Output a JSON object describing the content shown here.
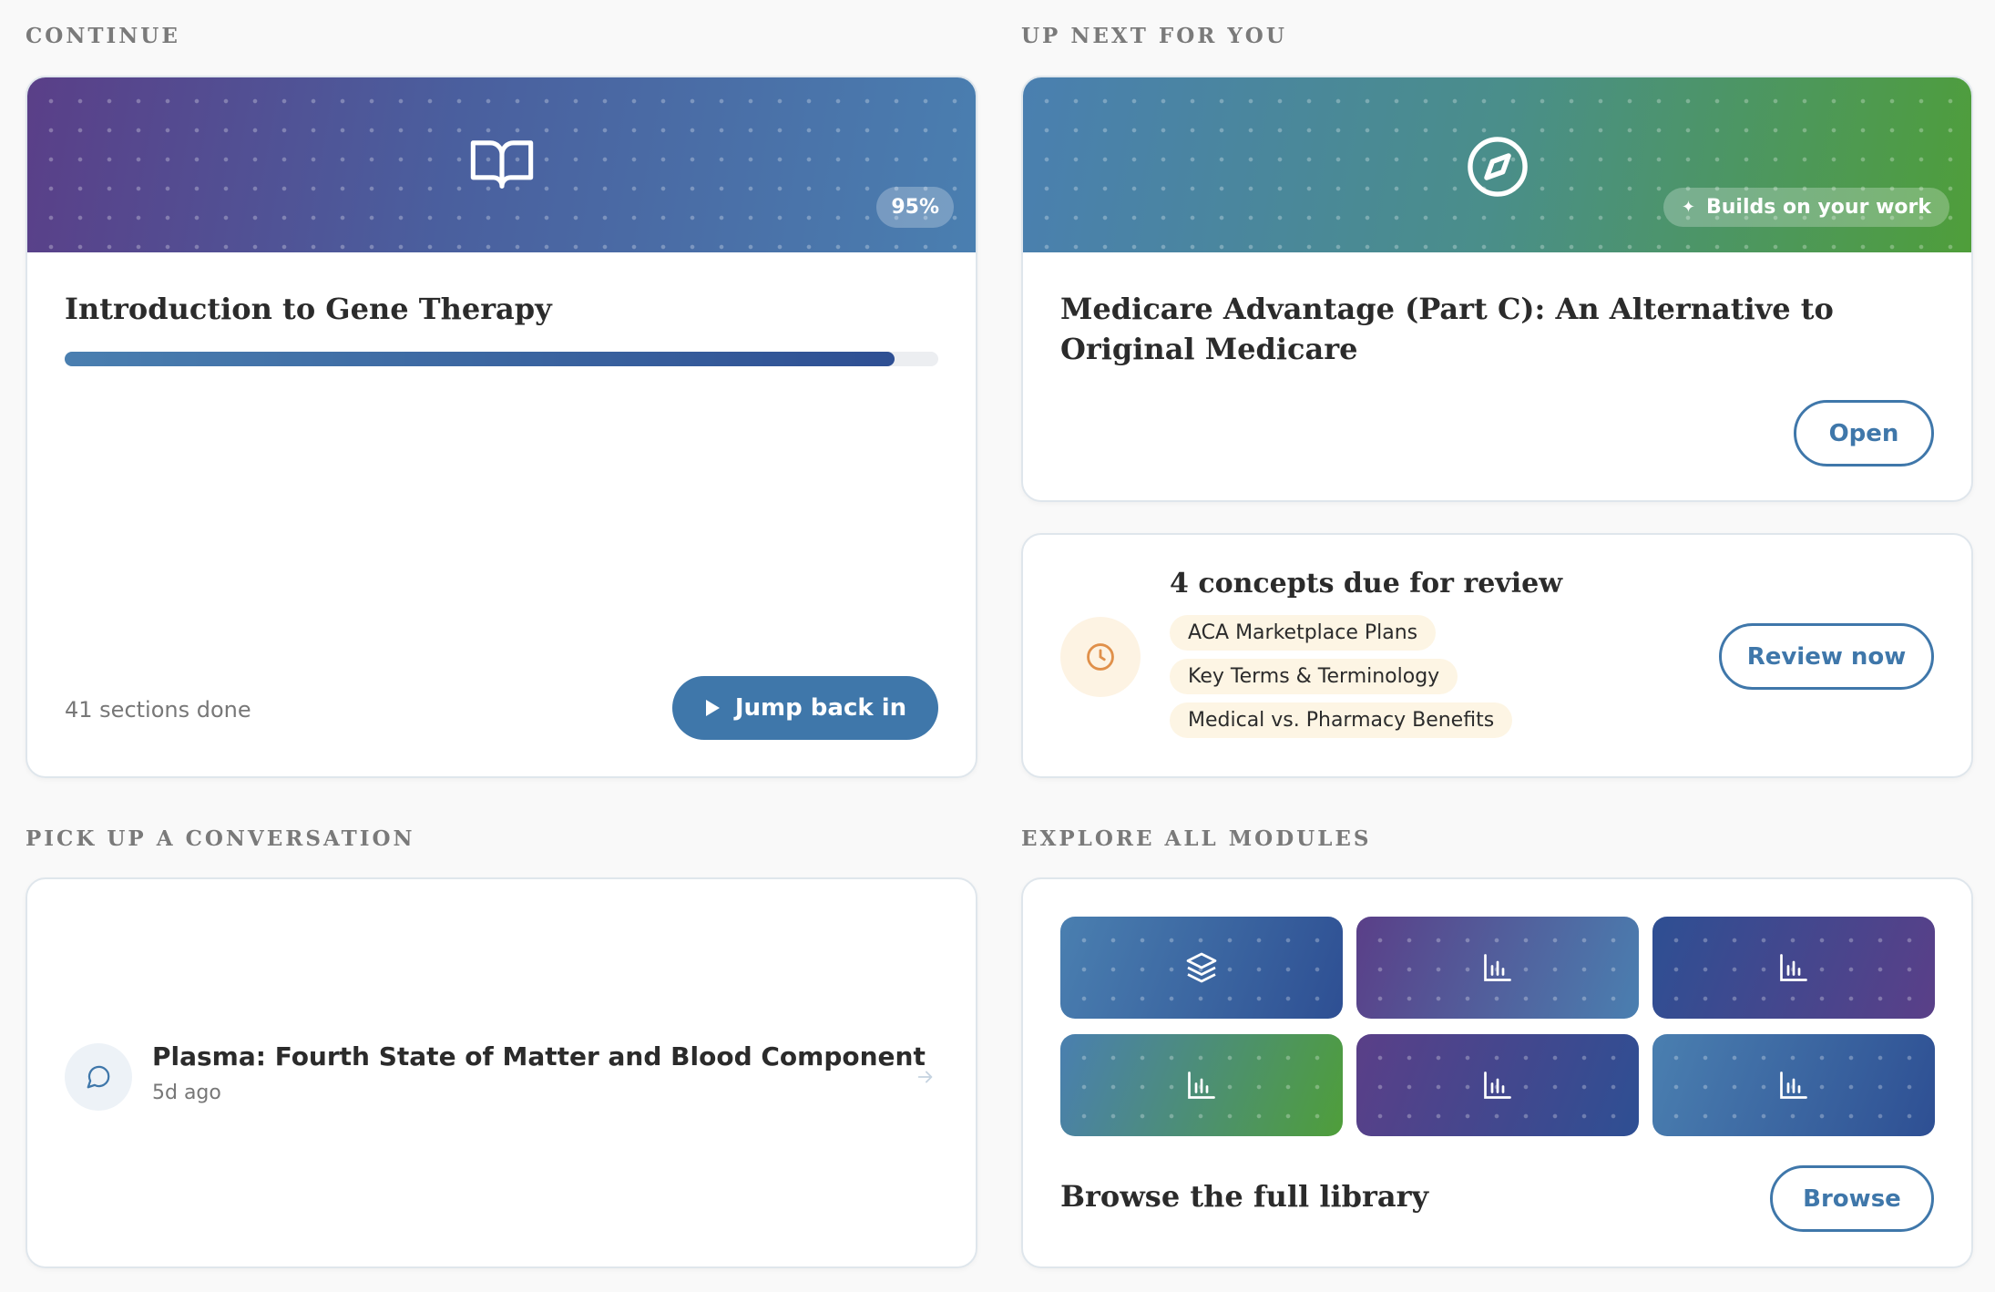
{
  "sections": {
    "continue": "CONTINUE",
    "up_next": "UP NEXT FOR YOU",
    "conversation": "PICK UP A CONVERSATION",
    "explore": "EXPLORE ALL MODULES"
  },
  "continue_card": {
    "icon": "open-book-icon",
    "progress_label": "95%",
    "progress": 0.95,
    "title": "Introduction to Gene Therapy",
    "sections_done": "41 sections done",
    "button_label": "Jump back in"
  },
  "up_next_card": {
    "icon": "compass-icon",
    "badge": "Builds on your work",
    "title": "Medicare Advantage (Part C): An Alternative to Original Medicare",
    "button_label": "Open"
  },
  "review_card": {
    "icon": "clock-icon",
    "title": "4 concepts due for review",
    "concepts": [
      "ACA Marketplace Plans",
      "Key Terms & Terminology",
      "Medical vs. Pharmacy Benefits"
    ],
    "button_label": "Review now"
  },
  "conversation_card": {
    "icon": "chat-bubble-icon",
    "title": "Plasma: Fourth State of Matter and Blood Component",
    "time": "5d ago"
  },
  "explore_card": {
    "tiles": [
      "layers-icon",
      "bar-chart-icon",
      "bar-chart-icon",
      "bar-chart-icon",
      "bar-chart-icon",
      "bar-chart-icon"
    ],
    "title": "Browse the full library",
    "button_label": "Browse"
  },
  "colors": {
    "accent": "#3f77aa",
    "purple": "#5a3f88",
    "green": "#4f9e3a",
    "review_orange": "#e0904a"
  }
}
